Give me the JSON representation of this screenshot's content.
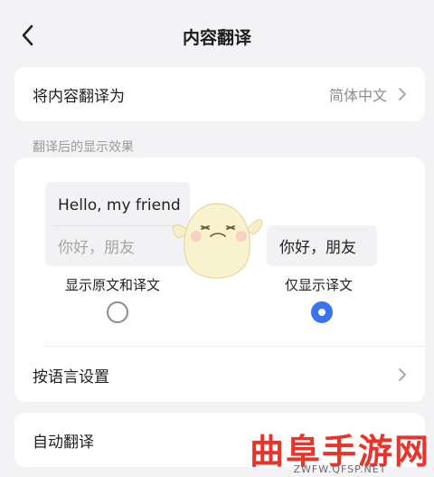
{
  "nav": {
    "title": "内容翻译"
  },
  "translate_to": {
    "label": "将内容翻译为",
    "value": "简体中文"
  },
  "section": {
    "label": "翻译后的显示效果"
  },
  "option_original_and_translation": {
    "preview_original": "Hello, my friend",
    "preview_translation": "你好，朋友",
    "label": "显示原文和译文",
    "selected": false
  },
  "option_translation_only": {
    "preview_translation": "你好，朋友",
    "label": "仅显示译文",
    "selected": true
  },
  "language_settings": {
    "label": "按语言设置"
  },
  "auto_translate": {
    "label": "自动翻译"
  },
  "watermark": {
    "text": "曲阜手游网",
    "url": "ZWFW.QFSP.NET"
  },
  "colors": {
    "accent": "#3a72f0",
    "watermark": "#e8342a",
    "background": "#f3f3f6"
  }
}
